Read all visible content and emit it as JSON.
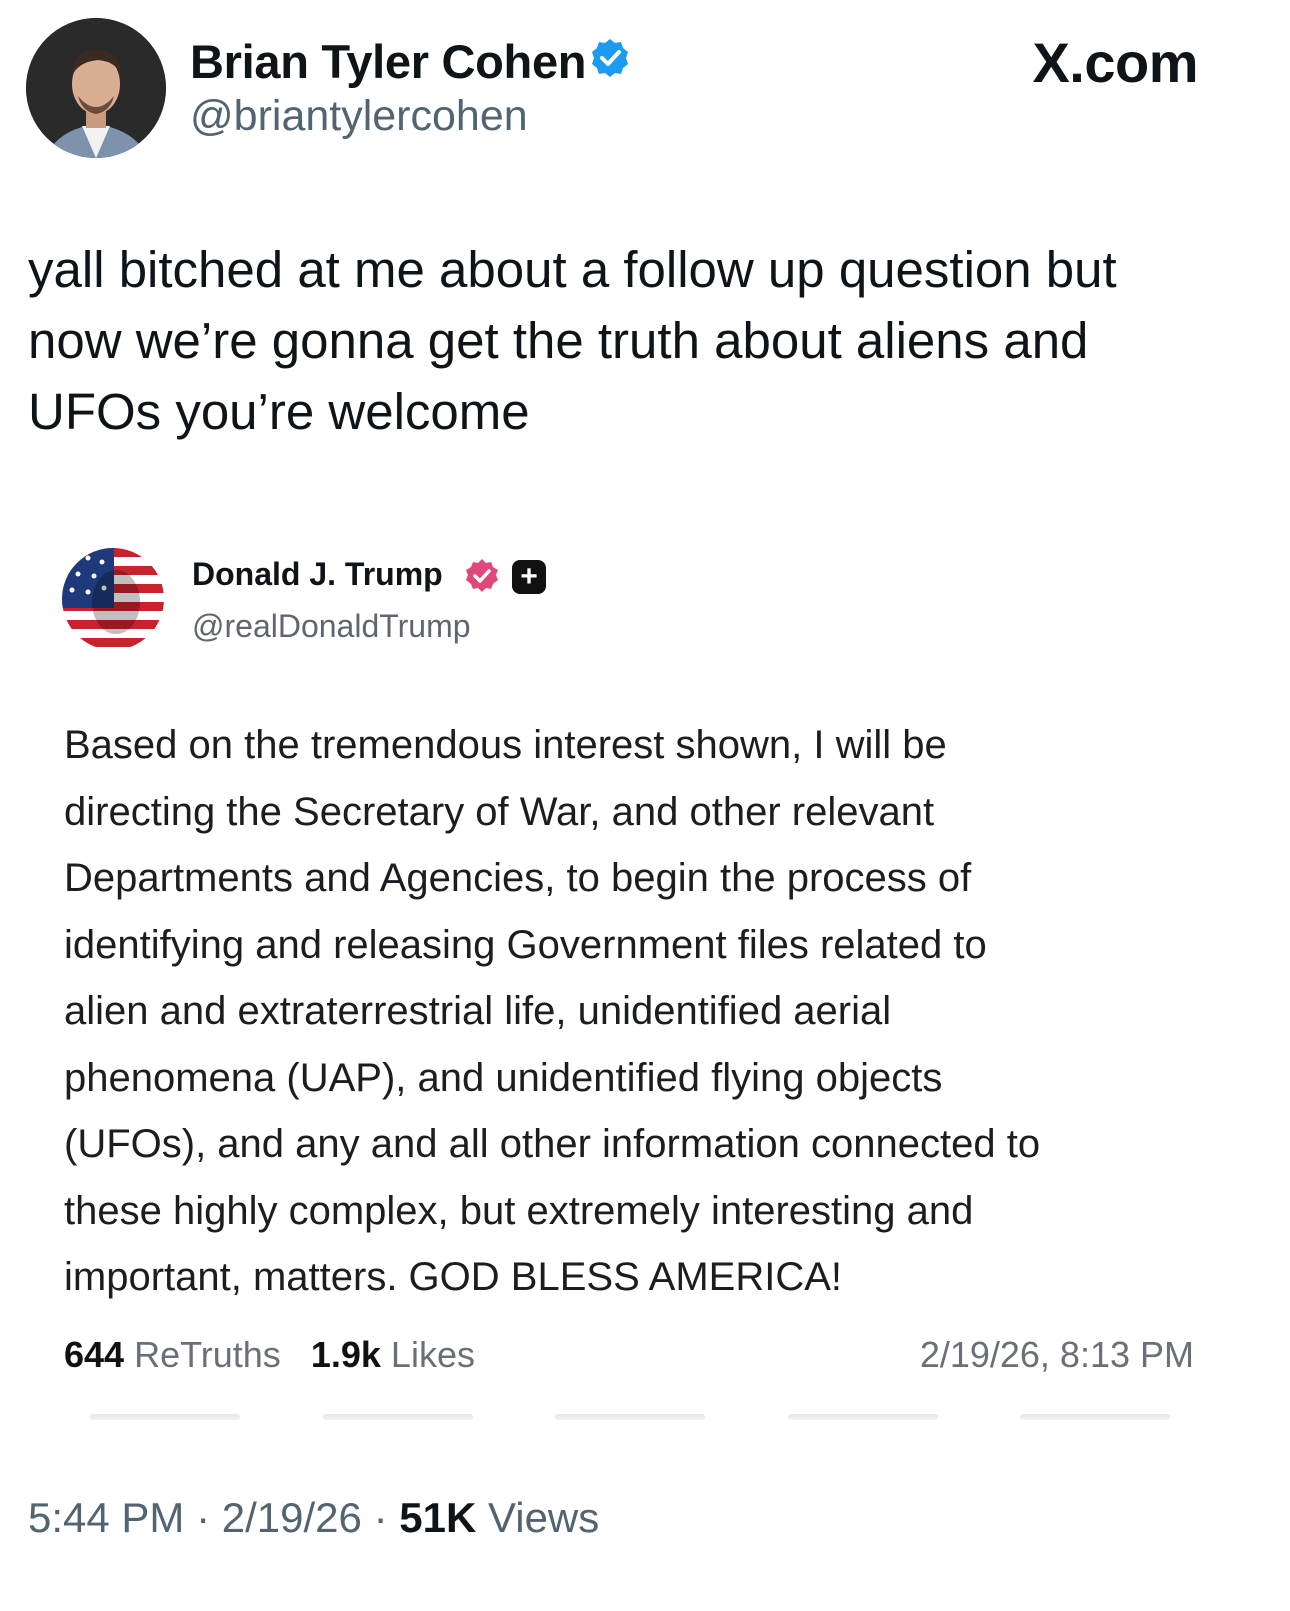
{
  "site_mark": "X.com",
  "author": {
    "name": "Brian Tyler Cohen",
    "handle": "@briantylercohen",
    "verified_color": "#1d9bf0"
  },
  "tweet": {
    "text": "yall bitched at me about a follow up question but\nnow we’re gonna get the truth about aliens and\nUFOs you’re welcome"
  },
  "embedded_post": {
    "name": "Donald J. Trump",
    "handle": "@realDonaldTrump",
    "verified_color": "#e0487a",
    "plus_glyph": "+",
    "text": "Based on the tremendous interest shown, I will be\ndirecting the Secretary of War, and other relevant\nDepartments and Agencies, to begin the process of\nidentifying and releasing Government files related to\nalien and extraterrestrial life, unidentified aerial\nphenomena (UAP), and unidentified flying objects\n(UFOs), and any and all other information connected to\nthese highly complex, but extremely interesting and\nimportant, matters. GOD BLESS AMERICA!",
    "retruths_count": "644",
    "retruths_label": "ReTruths",
    "likes_count": "1.9k",
    "likes_label": "Likes",
    "date": "2/19/26, 8:13 PM"
  },
  "footer": {
    "time": "5:44 PM",
    "separator": "·",
    "date": "2/19/26",
    "views_count": "51K",
    "views_label": "Views"
  }
}
